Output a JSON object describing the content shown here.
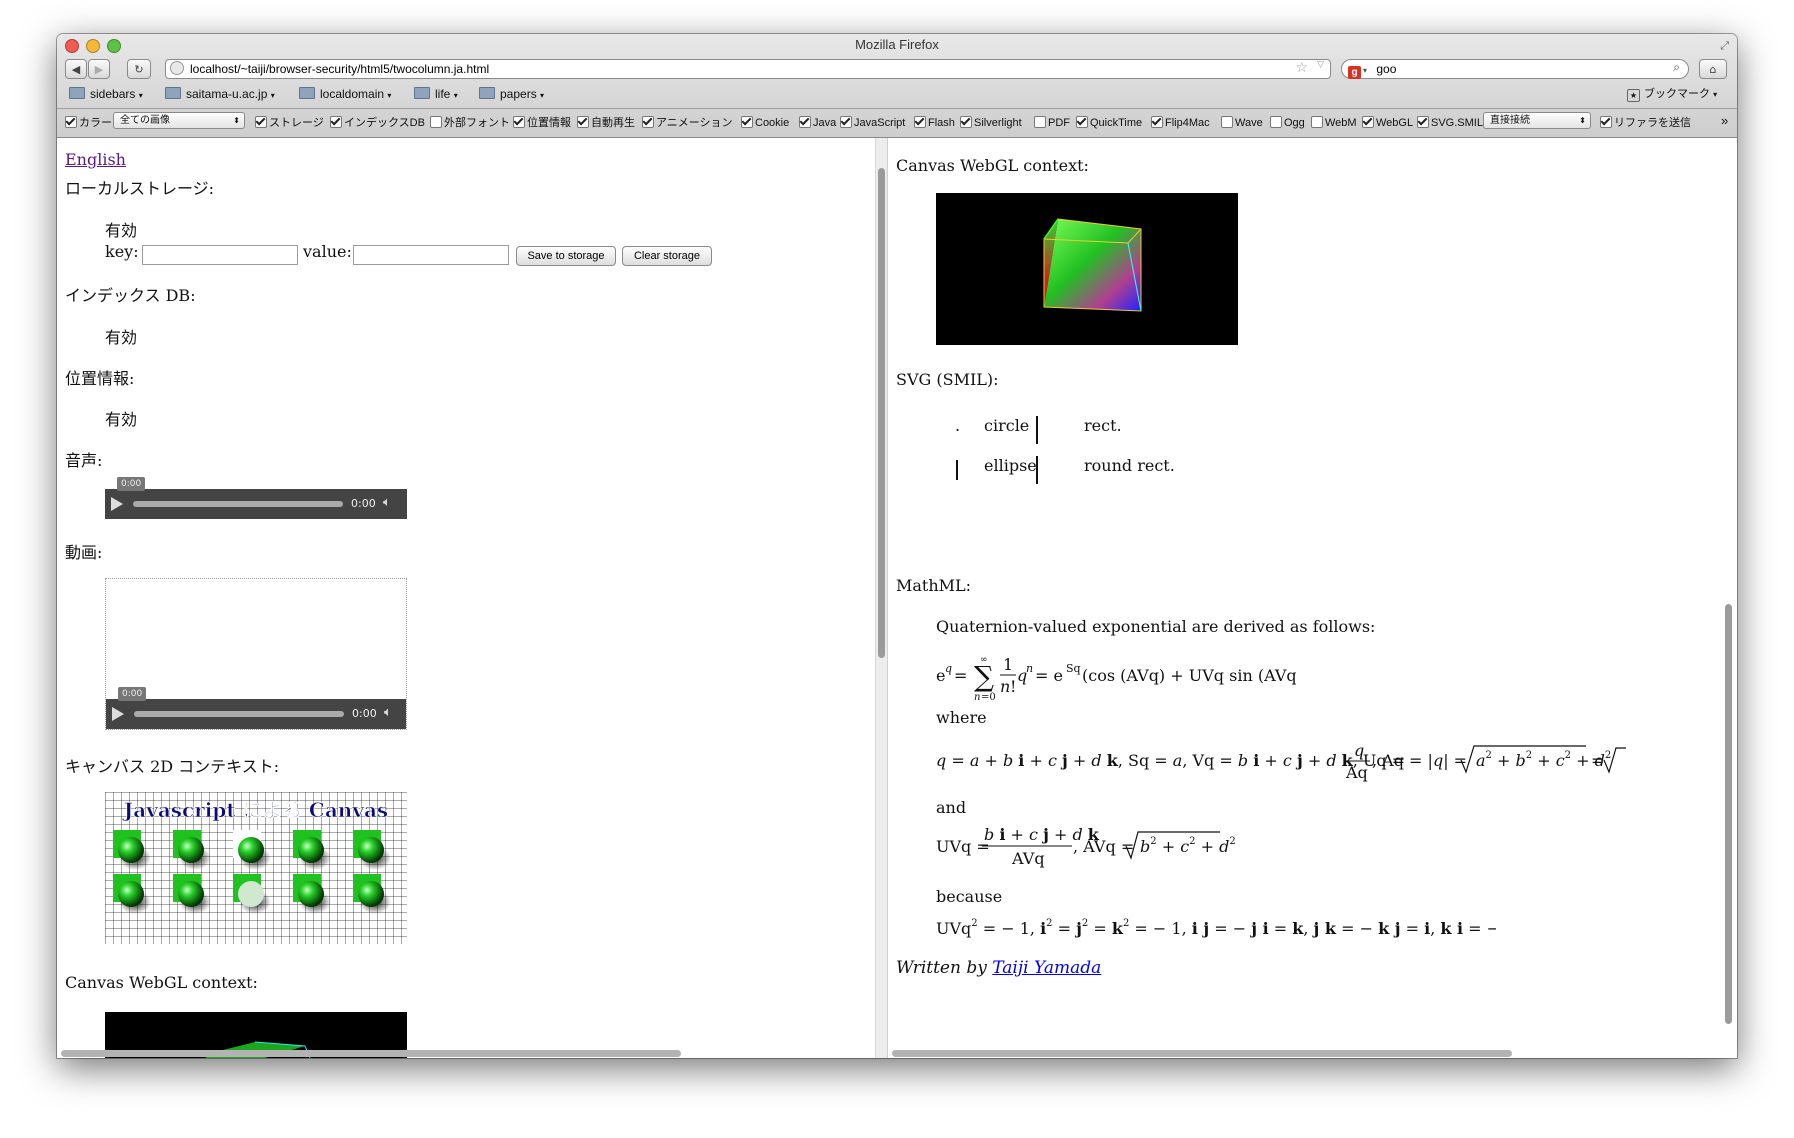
{
  "window": {
    "title": "Mozilla Firefox"
  },
  "toolbar": {
    "url": "localhost/~taiji/browser-security/html5/twocolumn.ja.html",
    "search_engine_label": "g",
    "search_value": "goo"
  },
  "bookmarks": {
    "folders": [
      "sidebars",
      "saitama-u.ac.jp",
      "localdomain",
      "life",
      "papers"
    ],
    "bookmarks_menu": "ブックマーク"
  },
  "webdev": {
    "items": [
      {
        "label": "カラー",
        "checked": true
      },
      {
        "label": "ストレージ",
        "checked": true
      },
      {
        "label": "インデックスDB",
        "checked": true
      },
      {
        "label": "外部フォント",
        "checked": false
      },
      {
        "label": "位置情報",
        "checked": true
      },
      {
        "label": "自動再生",
        "checked": true
      },
      {
        "label": "アニメーション",
        "checked": true
      },
      {
        "label": "Cookie",
        "checked": true
      },
      {
        "label": "Java",
        "checked": true
      },
      {
        "label": "JavaScript",
        "checked": true
      },
      {
        "label": "Flash",
        "checked": true
      },
      {
        "label": "Silverlight",
        "checked": true
      },
      {
        "label": "PDF",
        "checked": false
      },
      {
        "label": "QuickTime",
        "checked": true
      },
      {
        "label": "Flip4Mac",
        "checked": true
      },
      {
        "label": "Wave",
        "checked": false
      },
      {
        "label": "Ogg",
        "checked": false
      },
      {
        "label": "WebM",
        "checked": false
      },
      {
        "label": "WebGL",
        "checked": true
      },
      {
        "label": "SVG.SMIL",
        "checked": true
      },
      {
        "label": "リファラを送信",
        "checked": true
      }
    ],
    "images_select": "全ての画像",
    "proxy_select": "直接接続",
    "overflow": "»"
  },
  "left": {
    "english_link": "English",
    "local_storage_heading": "ローカルストレージ:",
    "local_storage_status": "有効",
    "key_label": "key:",
    "value_label": "value:",
    "key_value": "",
    "value_value": "",
    "save_button": "Save to storage",
    "clear_button": "Clear storage",
    "indexed_db_heading": "インデックス DB:",
    "indexed_db_status": "有効",
    "geo_heading": "位置情報:",
    "geo_status": "有効",
    "audio_heading": "音声:",
    "audio_time": "0:00",
    "audio_tip": "0:00",
    "video_heading": "動画:",
    "video_time": "0:00",
    "video_tip": "0:00",
    "canvas2d_heading": "キャンバス 2D コンテキスト:",
    "canvas2d_title": "Javascript による Canvas",
    "webgl_heading": "Canvas WebGL context:"
  },
  "right": {
    "webgl_heading": "Canvas WebGL context:",
    "svg_heading": "SVG (SMIL):",
    "svg_labels": {
      "circle": "circle",
      "rect": "rect.",
      "ellipse": "ellipse",
      "round_rect": "round rect.",
      "dot": "."
    },
    "mathml_heading": "MathML:",
    "intro": "Quaternion-valued exponential are derived as follows:",
    "where": "where",
    "and": "and",
    "because": "because",
    "written_by": "Written by",
    "author": "Taiji Yamada"
  },
  "colors": {
    "link": "#551a8b",
    "author_link": "#0000ee",
    "canvas_green": "#1fc21f"
  }
}
